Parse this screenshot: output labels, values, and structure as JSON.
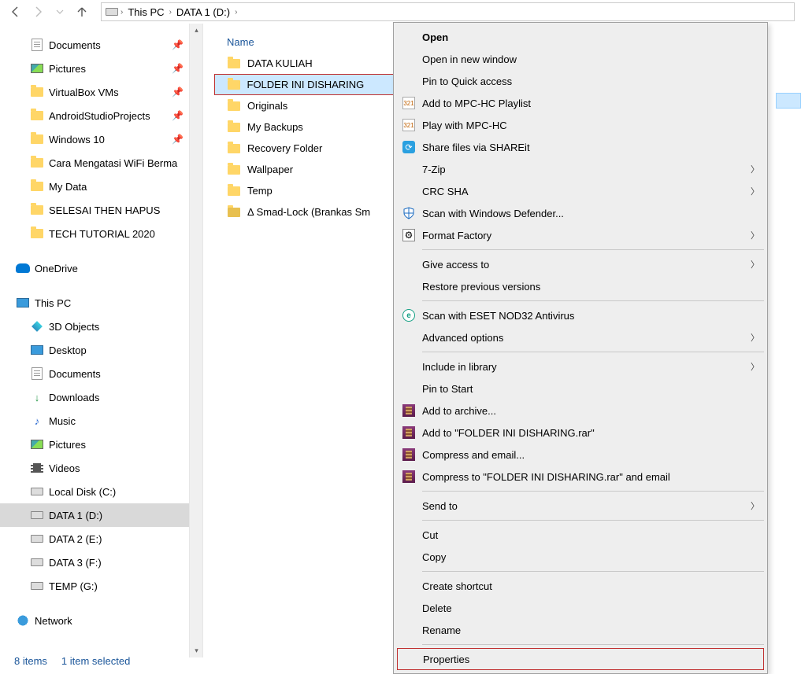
{
  "breadcrumb": {
    "root": "This PC",
    "drive": "DATA 1 (D:)"
  },
  "tree": {
    "quick": [
      {
        "label": "Documents",
        "icon": "doc",
        "pin": true
      },
      {
        "label": "Pictures",
        "icon": "pic",
        "pin": true
      },
      {
        "label": "VirtualBox VMs",
        "icon": "folder",
        "pin": true
      },
      {
        "label": "AndroidStudioProjects",
        "icon": "folder",
        "pin": true
      },
      {
        "label": "Windows 10",
        "icon": "folder",
        "pin": true
      },
      {
        "label": "Cara Mengatasi WiFi Berma",
        "icon": "folder",
        "pin": false
      },
      {
        "label": "My Data",
        "icon": "folder",
        "pin": false
      },
      {
        "label": "SELESAI THEN HAPUS",
        "icon": "folder",
        "pin": false
      },
      {
        "label": "TECH TUTORIAL 2020",
        "icon": "folder",
        "pin": false
      }
    ],
    "onedrive": "OneDrive",
    "thispc": "This PC",
    "pcitems": [
      {
        "label": "3D Objects",
        "icon": "3d"
      },
      {
        "label": "Desktop",
        "icon": "pc"
      },
      {
        "label": "Documents",
        "icon": "doc"
      },
      {
        "label": "Downloads",
        "icon": "dl"
      },
      {
        "label": "Music",
        "icon": "music"
      },
      {
        "label": "Pictures",
        "icon": "pic"
      },
      {
        "label": "Videos",
        "icon": "vid"
      },
      {
        "label": "Local Disk (C:)",
        "icon": "drive"
      },
      {
        "label": "DATA 1 (D:)",
        "icon": "drive",
        "selected": true
      },
      {
        "label": "DATA 2 (E:)",
        "icon": "drive"
      },
      {
        "label": "DATA 3 (F:)",
        "icon": "drive"
      },
      {
        "label": "TEMP (G:)",
        "icon": "drive"
      }
    ],
    "network": "Network"
  },
  "column_header": "Name",
  "files": [
    {
      "label": "DATA KULIAH",
      "icon": "folder"
    },
    {
      "label": "FOLDER INI DISHARING",
      "icon": "folder",
      "selected": true
    },
    {
      "label": "Originals",
      "icon": "folder"
    },
    {
      "label": "My Backups",
      "icon": "folder"
    },
    {
      "label": "Recovery Folder",
      "icon": "folder"
    },
    {
      "label": "Wallpaper",
      "icon": "folder"
    },
    {
      "label": "Temp",
      "icon": "folder"
    },
    {
      "label": "Δ Smad-Lock (Brankas Sm",
      "icon": "lockfolder"
    }
  ],
  "status": {
    "count": "8 items",
    "sel": "1 item selected"
  },
  "menu": [
    {
      "label": "Open",
      "bold": true
    },
    {
      "label": "Open in new window"
    },
    {
      "label": "Pin to Quick access"
    },
    {
      "label": "Add to MPC-HC Playlist",
      "icon": "mpc"
    },
    {
      "label": "Play with MPC-HC",
      "icon": "mpc"
    },
    {
      "label": "Share files via SHAREit",
      "icon": "shareit"
    },
    {
      "label": "7-Zip",
      "sub": true
    },
    {
      "label": "CRC SHA",
      "sub": true
    },
    {
      "label": "Scan with Windows Defender...",
      "icon": "defender"
    },
    {
      "label": "Format Factory",
      "icon": "ff",
      "sub": true
    },
    {
      "sep": true
    },
    {
      "label": "Give access to",
      "sub": true
    },
    {
      "label": "Restore previous versions"
    },
    {
      "sep": true
    },
    {
      "label": "Scan with ESET NOD32 Antivirus",
      "icon": "eset"
    },
    {
      "label": "Advanced options",
      "sub": true
    },
    {
      "sep": true
    },
    {
      "label": "Include in library",
      "sub": true
    },
    {
      "label": "Pin to Start"
    },
    {
      "label": "Add to archive...",
      "icon": "rar"
    },
    {
      "label": "Add to \"FOLDER INI DISHARING.rar\"",
      "icon": "rar"
    },
    {
      "label": "Compress and email...",
      "icon": "rar"
    },
    {
      "label": "Compress to \"FOLDER INI DISHARING.rar\" and email",
      "icon": "rar"
    },
    {
      "sep": true
    },
    {
      "label": "Send to",
      "sub": true
    },
    {
      "sep": true
    },
    {
      "label": "Cut"
    },
    {
      "label": "Copy"
    },
    {
      "sep": true
    },
    {
      "label": "Create shortcut"
    },
    {
      "label": "Delete"
    },
    {
      "label": "Rename"
    },
    {
      "sep": true
    },
    {
      "label": "Properties",
      "highlighted": true
    }
  ]
}
